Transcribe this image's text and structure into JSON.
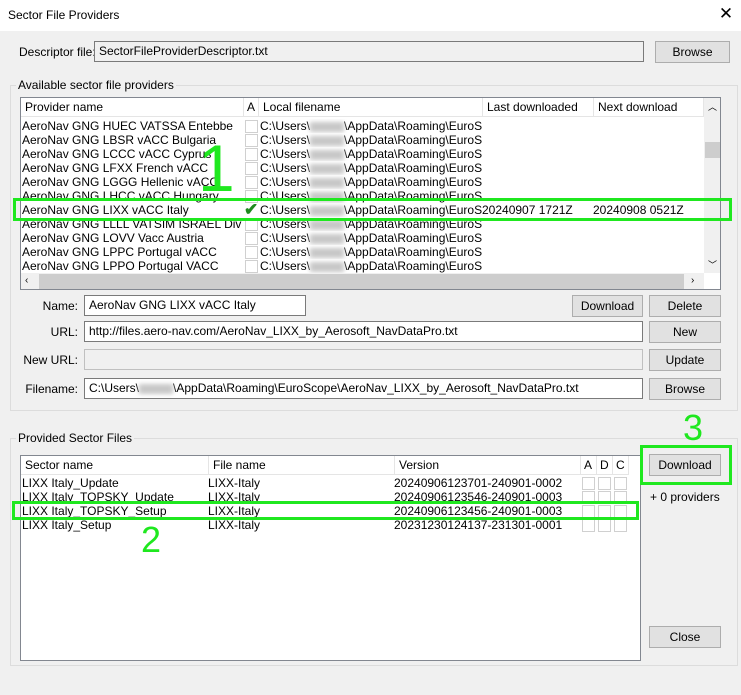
{
  "window": {
    "title": "Sector File Providers"
  },
  "descriptor": {
    "label": "Descriptor file:",
    "value": "SectorFileProviderDescriptor.txt",
    "browse": "Browse"
  },
  "providers_group": {
    "label": "Available sector file providers",
    "columns": [
      "Provider name",
      "A",
      "Local filename",
      "Last downloaded",
      "Next download"
    ],
    "rows": [
      {
        "name": "AeroNav GNG HUEC VATSSA Entebbe",
        "a": false,
        "pre": "C:\\Users\\",
        "post": "\\AppData\\Roaming\\EuroSco...",
        "last": "",
        "next": ""
      },
      {
        "name": "AeroNav GNG LBSR vACC Bulgaria",
        "a": false,
        "pre": "C:\\Users\\",
        "post": "\\AppData\\Roaming\\EuroSco...",
        "last": "",
        "next": ""
      },
      {
        "name": "AeroNav GNG LCCC vACC Cyprus",
        "a": false,
        "pre": "C:\\Users\\",
        "post": "\\AppData\\Roaming\\EuroSco...",
        "last": "",
        "next": ""
      },
      {
        "name": "AeroNav GNG LFXX French vACC",
        "a": false,
        "pre": "C:\\Users\\",
        "post": "\\AppData\\Roaming\\EuroSco...",
        "last": "",
        "next": ""
      },
      {
        "name": "AeroNav GNG LGGG Hellenic vACC",
        "a": false,
        "pre": "C:\\Users\\",
        "post": "\\AppData\\Roaming\\EuroSco...",
        "last": "",
        "next": ""
      },
      {
        "name": "AeroNav GNG LHCC vACC Hungary",
        "a": false,
        "pre": "C:\\Users\\",
        "post": "\\AppData\\Roaming\\EuroSco...",
        "last": "",
        "next": ""
      },
      {
        "name": "AeroNav GNG LIXX vACC Italy",
        "a": true,
        "pre": "C:\\Users\\",
        "post": "\\AppData\\Roaming\\EuroSco...",
        "last": "20240907 1721Z",
        "next": "20240908 0521Z"
      },
      {
        "name": "AeroNav GNG LLLL VATSIM ISRAEL Division",
        "a": false,
        "pre": "C:\\Users\\",
        "post": "\\AppData\\Roaming\\EuroSco...",
        "last": "",
        "next": ""
      },
      {
        "name": "AeroNav GNG LOVV Vacc Austria",
        "a": false,
        "pre": "C:\\Users\\",
        "post": "\\AppData\\Roaming\\EuroSco...",
        "last": "",
        "next": ""
      },
      {
        "name": "AeroNav GNG LPPC Portugal vACC",
        "a": false,
        "pre": "C:\\Users\\",
        "post": "\\AppData\\Roaming\\EuroSco...",
        "last": "",
        "next": ""
      },
      {
        "name": "AeroNav GNG LPPO Portugal VACC",
        "a": false,
        "pre": "C:\\Users\\",
        "post": "\\AppData\\Roaming\\EuroSco...",
        "last": "",
        "next": ""
      }
    ]
  },
  "form": {
    "name_label": "Name:",
    "name_value": "AeroNav GNG LIXX vACC Italy",
    "url_label": "URL:",
    "url_value": "http://files.aero-nav.com/AeroNav_LIXX_by_Aerosoft_NavDataPro.txt",
    "newurl_label": "New URL:",
    "newurl_value": "",
    "filename_label": "Filename:",
    "filename_pre": "C:\\Users\\",
    "filename_post": "\\AppData\\Roaming\\EuroScope\\AeroNav_LIXX_by_Aerosoft_NavDataPro.txt",
    "download": "Download",
    "delete": "Delete",
    "new": "New",
    "update": "Update",
    "browse": "Browse"
  },
  "sectors_group": {
    "label": "Provided Sector Files",
    "columns": [
      "Sector name",
      "File name",
      "Version",
      "A",
      "D",
      "C"
    ],
    "rows": [
      {
        "name": "LIXX Italy_Update",
        "file": "LIXX-Italy",
        "version": "20240906123701-240901-0002"
      },
      {
        "name": "LIXX Italy_TOPSKY_Update",
        "file": "LIXX-Italy",
        "version": "20240906123546-240901-0003"
      },
      {
        "name": "LIXX Italy_TOPSKY_Setup",
        "file": "LIXX-Italy",
        "version": "20240906123456-240901-0003"
      },
      {
        "name": "LIXX Italy_Setup",
        "file": "LIXX-Italy",
        "version": "20231230124137-231301-0001"
      }
    ],
    "download": "Download",
    "providers_count": "+ 0 providers",
    "close": "Close"
  },
  "annotations": {
    "n1": "1",
    "n2": "2",
    "n3": "3",
    "color": "#1fe81f"
  }
}
